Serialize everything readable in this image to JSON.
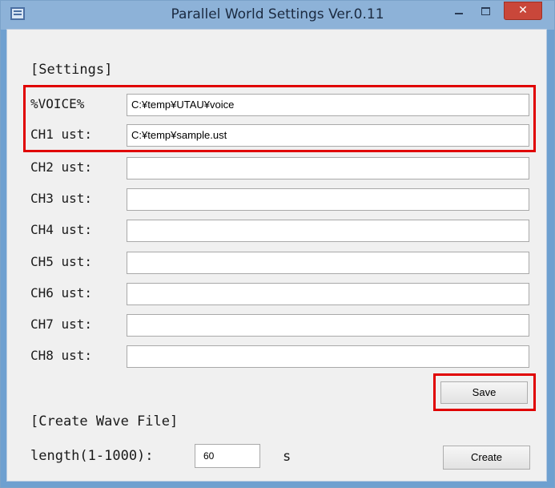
{
  "window": {
    "title": "Parallel World Settings Ver.0.11",
    "close_symbol": "✕",
    "icons": {
      "app": "app-window-icon",
      "minimize": "minimize-icon",
      "maximize": "maximize-icon",
      "close": "close-icon"
    }
  },
  "settings": {
    "heading": "[Settings]",
    "rows": [
      {
        "label": "%VOICE%",
        "value": "C:¥temp¥UTAU¥voice"
      },
      {
        "label": "CH1 ust:",
        "value": "C:¥temp¥sample.ust"
      },
      {
        "label": "CH2 ust:",
        "value": ""
      },
      {
        "label": "CH3 ust:",
        "value": ""
      },
      {
        "label": "CH4 ust:",
        "value": ""
      },
      {
        "label": "CH5 ust:",
        "value": ""
      },
      {
        "label": "CH6 ust:",
        "value": ""
      },
      {
        "label": "CH7 ust:",
        "value": ""
      },
      {
        "label": "CH8 ust:",
        "value": ""
      }
    ],
    "save_label": "Save"
  },
  "wave": {
    "heading": "[Create Wave File]",
    "length_label": "length(1-1000):",
    "length_value": "60",
    "unit": "s",
    "create_label": "Create"
  },
  "colors": {
    "highlight": "#e00000",
    "close_button": "#c9473a",
    "titlebar": "#8db2d8"
  }
}
